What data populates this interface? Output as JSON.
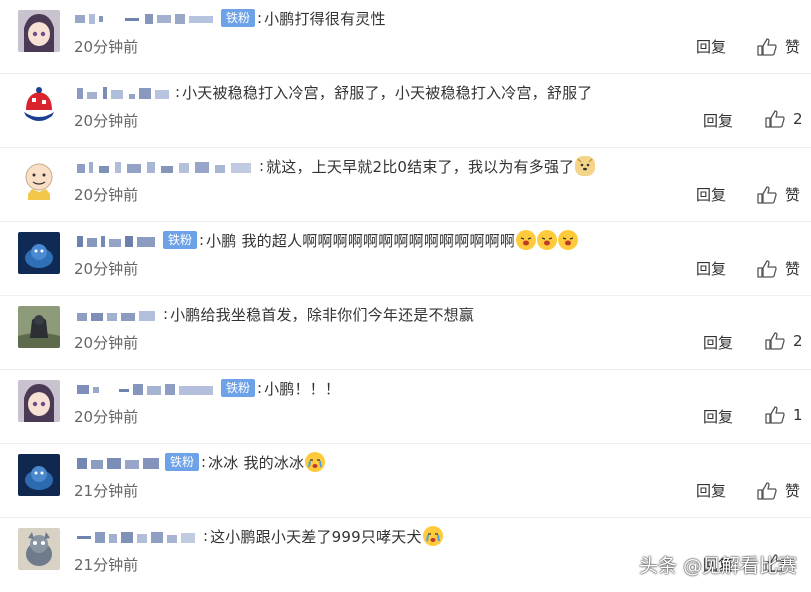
{
  "comments": [
    {
      "badge": "铁粉",
      "text": "小鹏打得很有灵性",
      "time": "20分钟前",
      "reply": "回复",
      "likes": "赞"
    },
    {
      "badge": "",
      "text": "小天被稳稳打入冷宫，舒服了，小天被稳稳打入冷宫，舒服了",
      "time": "20分钟前",
      "reply": "回复",
      "likes": "2"
    },
    {
      "badge": "",
      "text": "就这，上天早就2比0结束了，我以为有多强了",
      "time": "20分钟前",
      "reply": "回复",
      "likes": "赞"
    },
    {
      "badge": "铁粉",
      "text": "小鹏 我的超人啊啊啊啊啊啊啊啊啊啊啊啊啊啊",
      "time": "20分钟前",
      "reply": "回复",
      "likes": "赞"
    },
    {
      "badge": "",
      "text": "小鹏给我坐稳首发，除非你们今年还是不想赢",
      "time": "20分钟前",
      "reply": "回复",
      "likes": "2"
    },
    {
      "badge": "铁粉",
      "text": "小鹏！！！",
      "time": "20分钟前",
      "reply": "回复",
      "likes": "1"
    },
    {
      "badge": "铁粉",
      "text": "冰冰 我的冰冰",
      "time": "21分钟前",
      "reply": "回复",
      "likes": "赞"
    },
    {
      "badge": "",
      "text": "这小鹏跟小天差了999只哮天犬",
      "time": "21分钟前",
      "reply": "回复",
      "likes": ""
    }
  ],
  "watermark": "头条 @见解看比赛"
}
